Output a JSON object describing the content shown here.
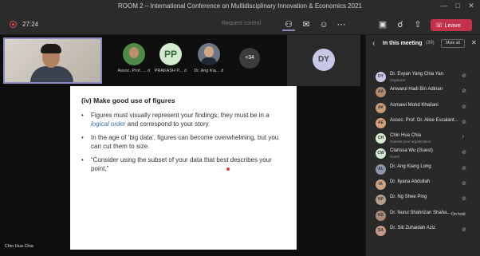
{
  "window": {
    "title": "ROOM 2 – International Conference on Multidisciplinary Innovation & Economics 2021",
    "minimize": "—",
    "maximize": "□",
    "close": "✕"
  },
  "toolbar": {
    "timer": "27:24",
    "request_control": "Request control",
    "buttons": [
      "participants-icon",
      "chat-icon",
      "reactions-icon",
      "more-icon",
      "camera-off-icon",
      "mic-off-icon",
      "share-icon"
    ],
    "leave_label": "Leave",
    "accent_color": "#c4314b"
  },
  "stage": {
    "tiles": [
      {
        "name": "Assoc. Prof. ...",
        "avatar": "photo"
      },
      {
        "name": "PRAKASH P...",
        "initials": "PP"
      },
      {
        "name": "Dr. Ang Kia...",
        "avatar": "photo"
      }
    ],
    "more_count": "+34",
    "dy_initials": "DY",
    "presenter_label": "Chin Hua Chia"
  },
  "slide": {
    "heading": "(iv)  Make good use of figures",
    "bullets": [
      {
        "pre": "Figures must visually represent your findings: they must be in a ",
        "em": "logical order",
        "post": " and correspond to your story."
      },
      {
        "pre": "In the age of ‘big data’, figures can become overwhelming, but you can cut them to size.",
        "em": "",
        "post": ""
      },
      {
        "pre": "“Consider using the subset of your data that best describes your point,”",
        "em": "",
        "post": ""
      }
    ]
  },
  "panel": {
    "title": "In this meeting",
    "count": "(39)",
    "mute_all": "Mute all",
    "participants": [
      {
        "initials": "DY",
        "name": "Dr. Evyan Yang Chia Yan",
        "sub": "Organizer",
        "color": "#c7c7e7",
        "status": "mic-off-icon"
      },
      {
        "initials": "AA",
        "name": "Anwarul Hadi Bin Adinan",
        "sub": "",
        "color": "#b58d6c",
        "status": "mic-off-icon"
      },
      {
        "initials": "AK",
        "name": "Asmawi Mohd Khailani",
        "sub": "",
        "color": "#c79a72",
        "status": "mic-off-icon"
      },
      {
        "initials": "AE",
        "name": "Assoc. Prof. Dr. Alice Escalant...",
        "sub": "",
        "color": "#d8a17e",
        "status": "mic-off-icon"
      },
      {
        "initials": "CH",
        "name": "Chin Hua Chia",
        "sub": "Outside your organization",
        "color": "#d9ead3",
        "status": "mic-on-icon"
      },
      {
        "initials": "CW",
        "name": "Clarissa Wu (Guest)",
        "sub": "Guest",
        "color": "#d2ecd0",
        "status": "mic-off-icon"
      },
      {
        "initials": "AL",
        "name": "Dr. Ang Kiang Long",
        "sub": "",
        "color": "#8a96aa",
        "status": "mic-off-icon"
      },
      {
        "initials": "IA",
        "name": "Dr. Ilyana Abdullah",
        "sub": "",
        "color": "#caa384",
        "status": "mic-off-icon"
      },
      {
        "initials": "NP",
        "name": "Dr. Ng Shee Ping",
        "sub": "",
        "color": "#b7a08a",
        "status": "mic-off-icon"
      },
      {
        "initials": "NS",
        "name": "Dr. Nurul Shahrizan Shaha...",
        "sub": "",
        "color": "#a98b77",
        "status": "on-hold",
        "status_text": "On hold"
      },
      {
        "initials": "SA",
        "name": "Dr. Siti Zuhaidah Aziz",
        "sub": "",
        "color": "#c49a86",
        "status": "mic-off-icon"
      }
    ]
  }
}
